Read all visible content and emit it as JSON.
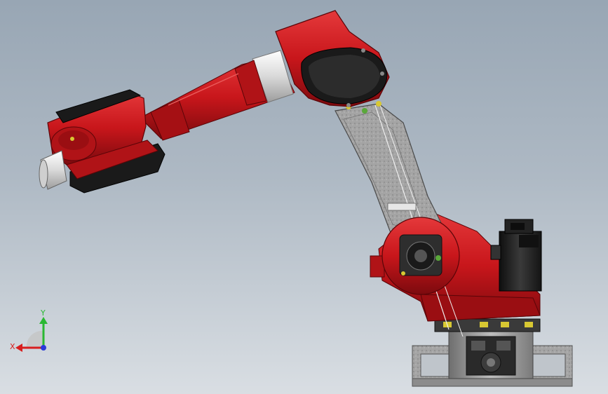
{
  "viewport": {
    "background_top": "#98a6b4",
    "background_bottom": "#d9dee3"
  },
  "colors": {
    "robot_red": "#c8161b",
    "robot_red_dark": "#8a0c10",
    "robot_red_light": "#e23a3a",
    "motor_black": "#1e1e1e",
    "silver_band": "#e6e6e6",
    "casting_gray": "#9a9a9a",
    "accent_yellow": "#d8c832",
    "accent_green": "#5aa83a"
  },
  "triad": {
    "y_label": "Y",
    "x_label": "X",
    "y_color": "#2ab832",
    "x_color": "#d81e1e",
    "z_color": "#2a3ad8",
    "icon": "axis-triad-icon"
  }
}
